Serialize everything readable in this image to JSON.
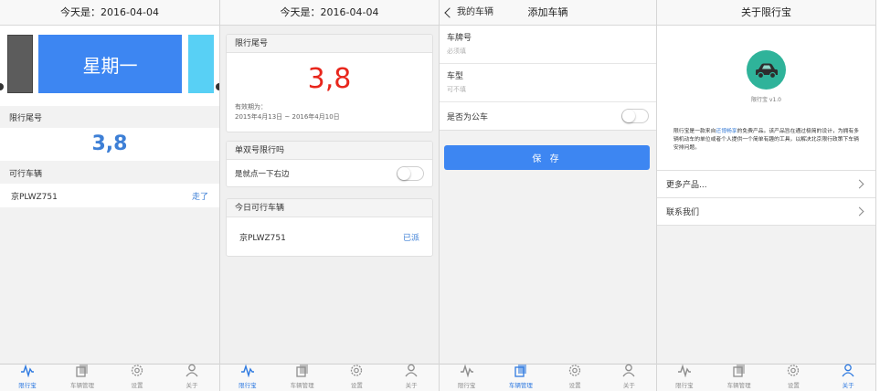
{
  "tabs": [
    "限行宝",
    "车辆管理",
    "设置",
    "关于"
  ],
  "colors": {
    "accent": "#3d86f2",
    "tab_active": "#2f7ae0",
    "red": "#e8261c",
    "app_icon_bg": "#2fb39a"
  },
  "screen1": {
    "nav_title": "今天是：2016-04-04",
    "weekday": "星期一",
    "restrict_header": "限行尾号",
    "restrict_numbers": "3,8",
    "allowed_header": "可行车辆",
    "car_plate": "京PLWZ751",
    "car_action": "走了",
    "active_tab": 0
  },
  "screen2": {
    "nav_title": "今天是：2016-04-04",
    "restrict_header": "限行尾号",
    "restrict_numbers": "3,8",
    "valid_label": "有效期为：",
    "valid_range": "2015年4月13日 ~ 2016年4月10日",
    "odd_even_header": "单双号限行吗",
    "odd_even_label": "是就点一下右边",
    "odd_even_on": false,
    "today_header": "今日可行车辆",
    "car_plate": "京PLWZ751",
    "car_action": "已派",
    "active_tab": 0
  },
  "screen3": {
    "back_label": "我的车辆",
    "nav_title": "添加车辆",
    "plate_label": "车牌号",
    "plate_placeholder": "必须填",
    "type_label": "车型",
    "type_placeholder": "可不填",
    "bus_label": "是否为公车",
    "bus_on": false,
    "save_label": "保 存",
    "active_tab": 1
  },
  "screen4": {
    "nav_title": "关于限行宝",
    "icon": "car-icon",
    "version": "限行宝 v1.0",
    "desc_1": "限行宝是一款来自",
    "desc_link": "还博畅享",
    "desc_2": "的免费产品。该产品旨在通过极简的设计，为拥有多辆机动车的单位或者个人提供一个简单有趣的工具，以解决北京限行政策下车辆安排问题。",
    "more_label": "更多产品...",
    "contact_label": "联系我们",
    "active_tab": 3
  }
}
